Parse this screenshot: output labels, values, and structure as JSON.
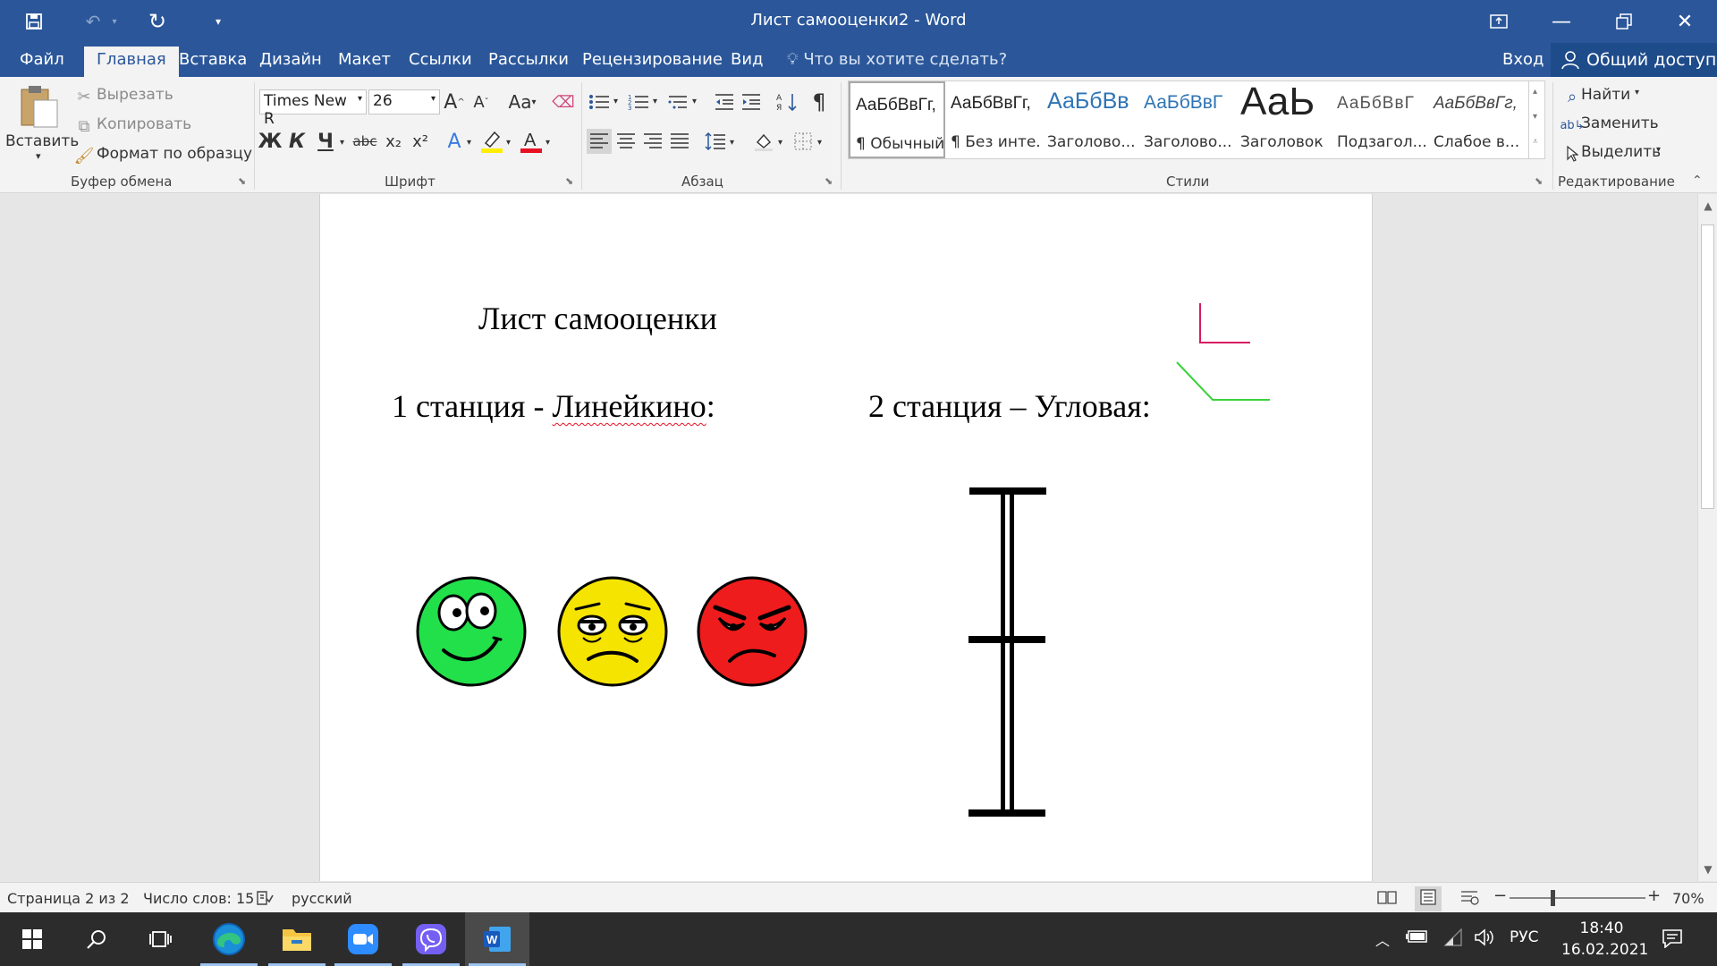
{
  "titlebar": {
    "title": "Лист самооценки2 - Word",
    "buttons": [
      "save-icon",
      "undo-icon",
      "redo-icon",
      "customize-qat-icon"
    ],
    "window": [
      "ribbon-display-icon",
      "minimize-icon",
      "restore-icon",
      "close-icon"
    ]
  },
  "tabs": {
    "file": "Файл",
    "items": [
      "Главная",
      "Вставка",
      "Дизайн",
      "Макет",
      "Ссылки",
      "Рассылки",
      "Рецензирование",
      "Вид"
    ],
    "tell_me": "Что вы хотите сделать?",
    "login": "Вход",
    "share": "Общий доступ"
  },
  "ribbon": {
    "clipboard": {
      "paste": "Вставить",
      "cut": "Вырезать",
      "copy": "Копировать",
      "format_painter": "Формат по образцу",
      "label": "Буфер обмена"
    },
    "font": {
      "name": "Times New R",
      "size": "26",
      "label": "Шрифт",
      "bold": "Ж",
      "italic": "К",
      "underline": "Ч",
      "strike": "abc",
      "subscript": "x₂",
      "superscript": "x²",
      "grow": "A",
      "shrink": "A",
      "case": "Aa"
    },
    "paragraph": {
      "label": "Абзац"
    },
    "styles": {
      "label": "Стили",
      "items": [
        {
          "preview": "АаБбВвГг,",
          "name": "¶ Обычный"
        },
        {
          "preview": "АаБбВвГг,",
          "name": "¶ Без инте..."
        },
        {
          "preview": "АаБбВв",
          "name": "Заголово..."
        },
        {
          "preview": "АаБбВвГ",
          "name": "Заголово..."
        },
        {
          "preview": "АаЬ",
          "name": "Заголовок"
        },
        {
          "preview": "АаБбВвГ",
          "name": "Подзагол..."
        },
        {
          "preview": "АаБбВвГг,",
          "name": "Слабое в..."
        }
      ]
    },
    "editing": {
      "label": "Редактирование",
      "find": "Найти",
      "replace": "Заменить",
      "select": "Выделить"
    }
  },
  "document": {
    "title": "Лист самооценки",
    "station1_prefix": "1 станция - ",
    "station1_name": "Линейкино",
    "station1_suffix": ":",
    "station2": "2 станция – Угловая:",
    "colors": {
      "happy": "#22e04a",
      "neutral": "#f5e400",
      "angry": "#ee1c1c",
      "right_angle": "#d81b60",
      "obtuse_angle": "#3ad23a"
    }
  },
  "statusbar": {
    "page": "Страница 2 из 2",
    "words": "Число слов: 15",
    "language": "русский",
    "zoom": "70%"
  },
  "taskbar": {
    "apps": [
      "start-icon",
      "search-icon",
      "task-view-icon",
      "edge-icon",
      "explorer-icon",
      "zoom-icon",
      "viber-icon",
      "word-icon"
    ],
    "lang": "РУС",
    "time": "18:40",
    "date": "16.02.2021"
  }
}
